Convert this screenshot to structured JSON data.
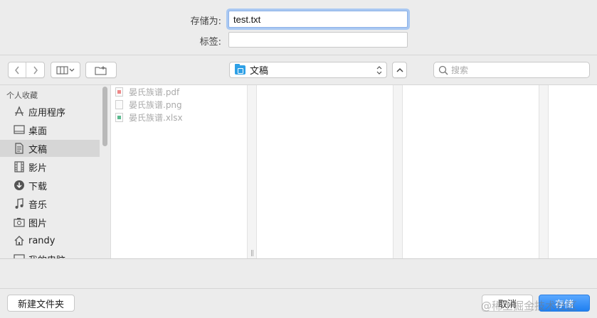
{
  "form": {
    "save_as_label": "存储为:",
    "save_as_value": "test.txt",
    "tags_label": "标签:"
  },
  "toolbar": {
    "location": "文稿",
    "search_placeholder": "搜索"
  },
  "sidebar": {
    "header": "个人收藏",
    "items": [
      {
        "label": "应用程序",
        "icon": "applications-icon"
      },
      {
        "label": "桌面",
        "icon": "desktop-icon"
      },
      {
        "label": "文稿",
        "icon": "documents-icon",
        "selected": true
      },
      {
        "label": "影片",
        "icon": "movies-icon"
      },
      {
        "label": "下载",
        "icon": "downloads-icon"
      },
      {
        "label": "音乐",
        "icon": "music-icon"
      },
      {
        "label": "图片",
        "icon": "pictures-icon"
      },
      {
        "label": "randy",
        "icon": "home-icon"
      },
      {
        "label": "我的电脑",
        "icon": "computer-icon"
      }
    ]
  },
  "files": [
    {
      "name": "晏氏族谱.pdf",
      "type": "pdf"
    },
    {
      "name": "晏氏族谱.png",
      "type": "png"
    },
    {
      "name": "晏氏族谱.xlsx",
      "type": "xlsx"
    }
  ],
  "footer": {
    "new_folder": "新建文件夹",
    "cancel": "取消",
    "save": "存储",
    "watermark": "@稀土掘金技术社区"
  },
  "colors": {
    "accent": "#1f7ff0",
    "focus_ring": "#a9c8f2",
    "folder": "#2ea0e6"
  }
}
